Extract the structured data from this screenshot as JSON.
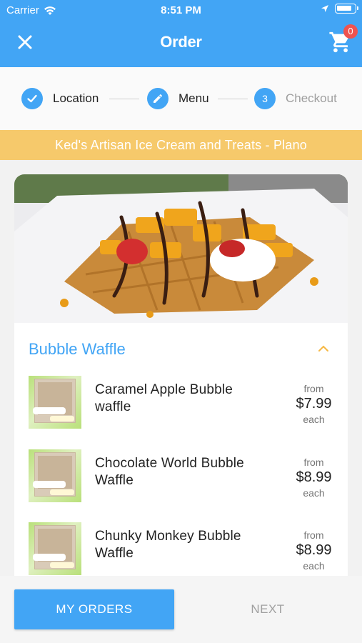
{
  "status_bar": {
    "carrier": "Carrier",
    "time": "8:51 PM"
  },
  "header": {
    "title": "Order",
    "cart_count": "0",
    "color": "#42a5f5"
  },
  "stepper": {
    "steps": [
      {
        "label": "Location",
        "state": "done",
        "icon": "check-icon"
      },
      {
        "label": "Menu",
        "state": "active",
        "icon": "pencil-icon"
      },
      {
        "label": "Checkout",
        "state": "pending",
        "number": "3"
      }
    ]
  },
  "store": {
    "name": "Ked's Artisan Ice Cream and Treats - Plano",
    "banner_color": "#f6c96b"
  },
  "menu": {
    "section_title": "Bubble Waffle",
    "items": [
      {
        "name": "Caramel Apple Bubble waffle",
        "from": "from",
        "price": "$7.99",
        "each": "each"
      },
      {
        "name": "Chocolate World Bubble Waffle",
        "from": "from",
        "price": "$8.99",
        "each": "each"
      },
      {
        "name": "Chunky Monkey Bubble Waffle",
        "from": "from",
        "price": "$8.99",
        "each": "each"
      }
    ]
  },
  "actions": {
    "my_orders": "MY ORDERS",
    "next": "NEXT"
  }
}
